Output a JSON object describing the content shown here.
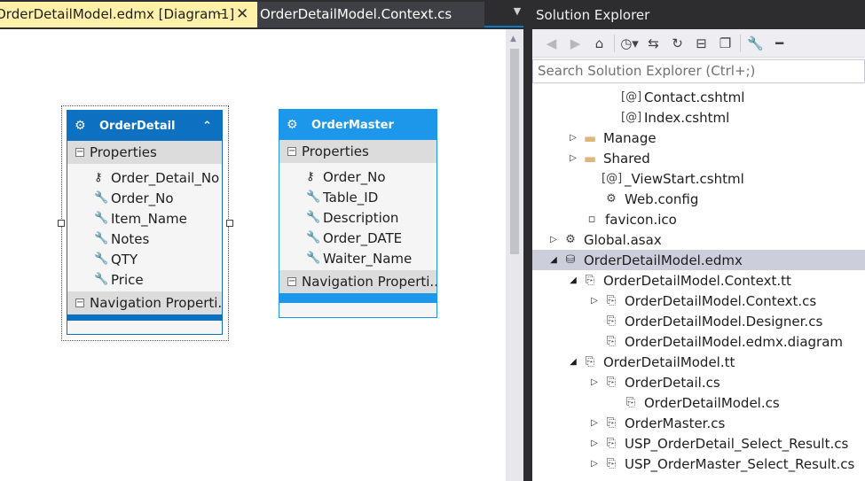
{
  "tabs": {
    "active_label": "OrderDetailModel.edmx [Diagram1]",
    "pin_glyph": "⊣",
    "close_glyph": "✕",
    "inactive_label": "OrderDetailModel.Context.cs",
    "dropdown_glyph": "▼"
  },
  "entities": [
    {
      "title": "OrderDetail",
      "header_color": "#0e70c0",
      "properties_label": "Properties",
      "properties": [
        {
          "name": "Order_Detail_No",
          "icon": "key-icon"
        },
        {
          "name": "Order_No",
          "icon": "wrench-icon"
        },
        {
          "name": "Item_Name",
          "icon": "wrench-icon"
        },
        {
          "name": "Notes",
          "icon": "wrench-icon"
        },
        {
          "name": "QTY",
          "icon": "wrench-icon"
        },
        {
          "name": "Price",
          "icon": "wrench-icon"
        }
      ],
      "navigation_label": "Navigation Properti..."
    },
    {
      "title": "OrderMaster",
      "header_color": "#1c97ea",
      "properties_label": "Properties",
      "properties": [
        {
          "name": "Order_No",
          "icon": "key-icon"
        },
        {
          "name": "Table_ID",
          "icon": "wrench-icon"
        },
        {
          "name": "Description",
          "icon": "wrench-icon"
        },
        {
          "name": "Order_DATE",
          "icon": "wrench-icon"
        },
        {
          "name": "Waiter_Name",
          "icon": "wrench-icon"
        }
      ],
      "navigation_label": "Navigation Properti..."
    }
  ],
  "solution_explorer": {
    "title": "Solution Explorer",
    "search_placeholder": "Search Solution Explorer (Ctrl+;)",
    "toolbar": [
      {
        "name": "back-icon",
        "glyph": "◀",
        "disabled": true
      },
      {
        "name": "forward-icon",
        "glyph": "▶",
        "disabled": true
      },
      {
        "name": "home-icon",
        "glyph": "⌂",
        "disabled": false
      },
      {
        "name": "pending-changes-icon",
        "glyph": "◷▾",
        "disabled": false
      },
      {
        "name": "sync-icon",
        "glyph": "⇆",
        "disabled": false
      },
      {
        "name": "refresh-icon",
        "glyph": "↻",
        "disabled": false
      },
      {
        "name": "collapse-all-icon",
        "glyph": "⊟",
        "disabled": false
      },
      {
        "name": "show-all-files-icon",
        "glyph": "❐",
        "disabled": false
      },
      {
        "name": "properties-icon",
        "glyph": "🔧",
        "disabled": false
      },
      {
        "name": "pin-icon",
        "glyph": "━",
        "disabled": false
      }
    ],
    "tree": [
      {
        "label": "Contact.cshtml",
        "indent": 100,
        "expander": "",
        "icon": "razor-icon",
        "glyph": "[@]"
      },
      {
        "label": "Index.cshtml",
        "indent": 100,
        "expander": "",
        "icon": "razor-icon",
        "glyph": "[@]"
      },
      {
        "label": "Manage",
        "indent": 54,
        "expander": "▷",
        "icon": "folder-icon",
        "glyph": "▬"
      },
      {
        "label": "Shared",
        "indent": 54,
        "expander": "▷",
        "icon": "folder-icon",
        "glyph": "▬"
      },
      {
        "label": "_ViewStart.cshtml",
        "indent": 78,
        "expander": "",
        "icon": "razor-icon",
        "glyph": "[@]"
      },
      {
        "label": "Web.config",
        "indent": 78,
        "expander": "",
        "icon": "config-icon",
        "glyph": "⚙"
      },
      {
        "label": "favicon.ico",
        "indent": 56,
        "expander": "",
        "icon": "file-icon",
        "glyph": "▫"
      },
      {
        "label": "Global.asax",
        "indent": 32,
        "expander": "▷",
        "icon": "global-asax-icon",
        "glyph": "⚙"
      },
      {
        "label": "OrderDetailModel.edmx",
        "indent": 32,
        "expander": "◢",
        "icon": "edmx-icon",
        "glyph": "⛁",
        "selected": true
      },
      {
        "label": "OrderDetailModel.Context.tt",
        "indent": 54,
        "expander": "◢",
        "icon": "tt-file-icon",
        "glyph": "⎘"
      },
      {
        "label": "OrderDetailModel.Context.cs",
        "indent": 78,
        "expander": "▷",
        "icon": "cs-file-icon",
        "glyph": "⎘"
      },
      {
        "label": "OrderDetailModel.Designer.cs",
        "indent": 78,
        "expander": "",
        "icon": "cs-file-icon",
        "glyph": "⎘"
      },
      {
        "label": "OrderDetailModel.edmx.diagram",
        "indent": 78,
        "expander": "",
        "icon": "diagram-file-icon",
        "glyph": "⎘"
      },
      {
        "label": "OrderDetailModel.tt",
        "indent": 54,
        "expander": "◢",
        "icon": "tt-file-icon",
        "glyph": "⎘"
      },
      {
        "label": "OrderDetail.cs",
        "indent": 78,
        "expander": "▷",
        "icon": "cs-file-icon",
        "glyph": "⎘"
      },
      {
        "label": "OrderDetailModel.cs",
        "indent": 100,
        "expander": "",
        "icon": "cs-file-icon",
        "glyph": "⎘"
      },
      {
        "label": "OrderMaster.cs",
        "indent": 78,
        "expander": "▷",
        "icon": "cs-file-icon",
        "glyph": "⎘"
      },
      {
        "label": "USP_OrderDetail_Select_Result.cs",
        "indent": 78,
        "expander": "▷",
        "icon": "cs-file-icon",
        "glyph": "⎘"
      },
      {
        "label": "USP_OrderMaster_Select_Result.cs",
        "indent": 78,
        "expander": "▷",
        "icon": "cs-file-icon",
        "glyph": "⎘"
      }
    ]
  }
}
